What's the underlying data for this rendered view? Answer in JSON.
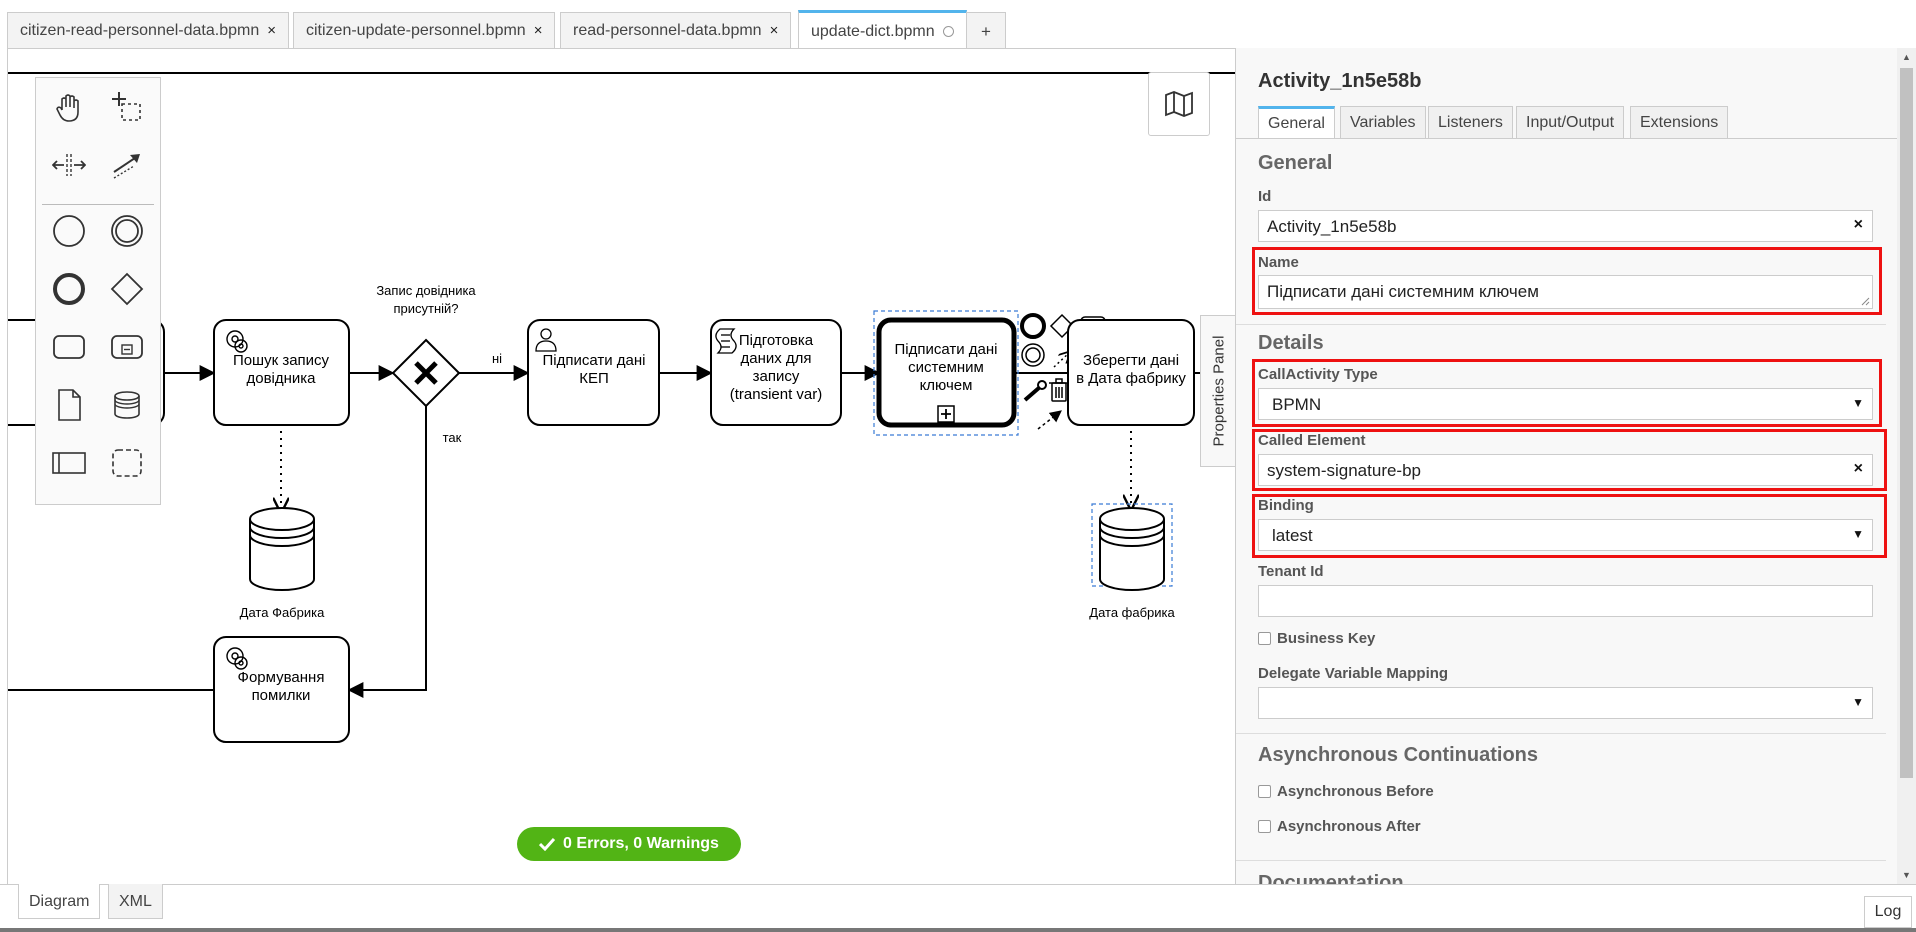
{
  "file_tabs": [
    {
      "label": "citizen-read-personnel-data.bpmn",
      "close": "×"
    },
    {
      "label": "citizen-update-personnel.bpmn",
      "close": "×"
    },
    {
      "label": "read-personnel-data.bpmn",
      "close": "×"
    },
    {
      "label": "update-dict.bpmn",
      "active": true
    }
  ],
  "new_tab_label": "+",
  "diagram": {
    "tasks": {
      "search": "Пошук запису довідника",
      "sign_kep": "Підписати дані КЕП",
      "prepare": "Підготовка даних для запису (transient var)",
      "sign_system": "Підписати дані системним ключем",
      "save": "Зберегти дані в Дата фабрику",
      "error": "Формування помилки"
    },
    "gateway_label": "Запис довідника присутній?",
    "flow_no": "ні",
    "flow_yes": "так",
    "store_left": "Дата Фабрика",
    "store_right": "Дата фабрика"
  },
  "status": "0 Errors, 0 Warnings",
  "properties_toggle": "Properties Panel",
  "panel": {
    "title": "Activity_1n5e58b",
    "tabs": [
      "General",
      "Variables",
      "Listeners",
      "Input/Output",
      "Extensions"
    ],
    "general_title": "General",
    "id_label": "Id",
    "id_value": "Activity_1n5e58b",
    "name_label": "Name",
    "name_value": "Підписати дані системним ключем",
    "details_title": "Details",
    "calltype_label": "CallActivity Type",
    "calltype_value": "BPMN",
    "called_label": "Called Element",
    "called_value": "system-signature-bp",
    "binding_label": "Binding",
    "binding_value": "latest",
    "tenant_label": "Tenant Id",
    "tenant_value": "",
    "business_key_label": "Business Key",
    "delegate_label": "Delegate Variable Mapping",
    "delegate_value": "",
    "async_title": "Asynchronous Continuations",
    "async_before": "Asynchronous Before",
    "async_after": "Asynchronous After",
    "doc_title": "Documentation",
    "clear_symbol": "×",
    "caret_symbol": "▼"
  },
  "bottom_tabs": [
    "Diagram",
    "XML"
  ],
  "log_label": "Log",
  "colors": {
    "accent": "#52b4ec",
    "success": "#52b415",
    "highlight": "#ee1111"
  }
}
